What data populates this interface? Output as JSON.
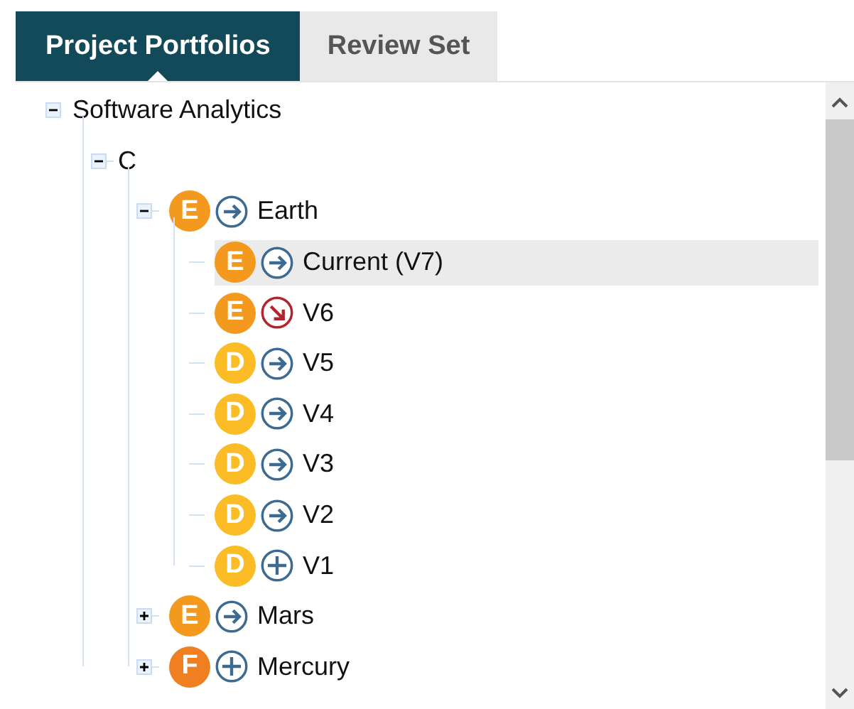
{
  "tabs": [
    {
      "label": "Project Portfolios",
      "selected": true
    },
    {
      "label": "Review Set",
      "selected": false
    }
  ],
  "tree": [
    {
      "label": "Software Analytics",
      "expanded": true,
      "selected": false,
      "children": [
        {
          "label": "C",
          "expanded": true,
          "selected": false,
          "children": [
            {
              "label": "Earth",
              "grade": "E",
              "color": "#f39a1e",
              "kind": "arrow",
              "expanded": true,
              "selected": false,
              "children": [
                {
                  "label": "Current (V7)",
                  "grade": "E",
                  "color": "#f39a1e",
                  "kind": "arrow",
                  "selected": true
                },
                {
                  "label": "V6",
                  "grade": "E",
                  "color": "#f39a1e",
                  "kind": "down",
                  "selected": false
                },
                {
                  "label": "V5",
                  "grade": "D",
                  "color": "#fbbc25",
                  "kind": "arrow",
                  "selected": false
                },
                {
                  "label": "V4",
                  "grade": "D",
                  "color": "#fbbc25",
                  "kind": "arrow",
                  "selected": false
                },
                {
                  "label": "V3",
                  "grade": "D",
                  "color": "#fbbc25",
                  "kind": "arrow",
                  "selected": false
                },
                {
                  "label": "V2",
                  "grade": "D",
                  "color": "#fbbc25",
                  "kind": "arrow",
                  "selected": false
                },
                {
                  "label": "V1",
                  "grade": "D",
                  "color": "#fbbc25",
                  "kind": "plus",
                  "selected": false
                }
              ]
            },
            {
              "label": "Mars",
              "grade": "E",
              "color": "#f39a1e",
              "kind": "arrow",
              "expanded": false,
              "selected": false
            },
            {
              "label": "Mercury",
              "grade": "F",
              "color": "#f07f22",
              "kind": "plus",
              "expanded": false,
              "selected": false
            }
          ]
        }
      ]
    }
  ]
}
